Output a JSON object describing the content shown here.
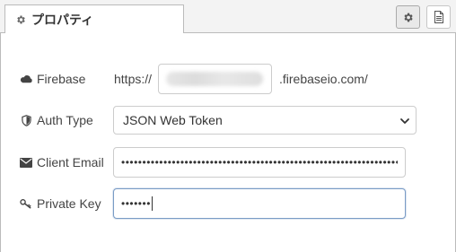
{
  "tab": {
    "title": "プロパティ",
    "icon": "gear-icon"
  },
  "tab_buttons": [
    {
      "icon": "gear-icon",
      "active": true
    },
    {
      "icon": "document-icon",
      "active": false
    }
  ],
  "form": {
    "firebase": {
      "label": "Firebase",
      "icon": "cloud-icon",
      "prefix": "https://",
      "value_redacted": true,
      "suffix": ".firebaseio.com/"
    },
    "auth_type": {
      "label": "Auth Type",
      "icon": "shield-icon",
      "selected": "JSON Web Token"
    },
    "client_email": {
      "label": "Client Email",
      "icon": "envelope-icon",
      "masked_value": "••••••••••••••••••••••••••••••••••••••••••••••••••••••••••••••••••"
    },
    "private_key": {
      "label": "Private Key",
      "icon": "key-icon",
      "masked_value": "•••••••"
    }
  },
  "colors": {
    "border": "#cccccc",
    "focus_border": "#7a9cc6",
    "text": "#444444"
  }
}
